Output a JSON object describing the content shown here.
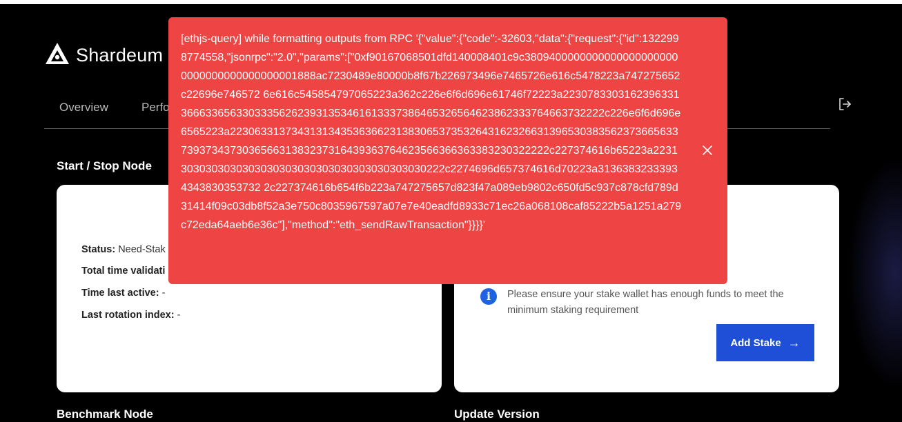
{
  "app": {
    "brand": "Shardeum"
  },
  "nav": {
    "items": [
      {
        "label": "Overview"
      },
      {
        "label": "Perfo"
      }
    ]
  },
  "sections": {
    "start_stop": "Start / Stop Node",
    "benchmark": "Benchmark Node",
    "update": "Update Version"
  },
  "node_status": {
    "status_label": "Status:",
    "status_value": "Need-Stak",
    "total_time_label": "Total time validati",
    "time_last_active_label": "Time last active:",
    "time_last_active_value": "-",
    "last_rotation_label": "Last rotation index:",
    "last_rotation_value": "-"
  },
  "stake": {
    "notice": "Please ensure your stake wallet has enough funds to meet the minimum staking requirement",
    "button_label": "Add Stake",
    "button_arrow": "→"
  },
  "toast": {
    "message": "[ethjs-query] while formatting outputs from RPC '{\"value\":{\"code\":-32603,\"data\":{\"request\":{\"id\":1322998774558,\"jsonrpc\":\"2.0\",\"params\":[\"0xf90167068501dfd140008401c9c38094000000000000000000000000000000000000001888ac7230489e80000b8f67b226973496e7465726e616c5478223a747275652c22696e746572 6e616c545854797065223a362c226e6f6d696e61746f72223a2230783303162396331366633656330333562623931353461613337386465326564623862333764663732222c226e6f6d696e6565223a2230633137343131343536366231383065373532643162326631396530383562373665633739373437303656631383237316439363764623566366363383230322222c227374616b65223a22313030303030303030303030303030303030303030222c2274696d657374616d70223a31363832333934343830353732 2c227374616b654f6b223a747275657d823f47a089eb9802c650fd5c937c878cfd789d31414f09c03db8f52a3e750c8035967597a07e7e40eadfd8933c71ec26a068108caf85222b5a1251a279c72eda64aeb6e36c\"],\"method\":\"eth_sendRawTransaction\"}}}}'"
  },
  "colors": {
    "toast_bg": "#ef4444",
    "primary_button": "#1f4fd7",
    "info_icon": "#1f63e3",
    "page_bg": "#000000"
  }
}
